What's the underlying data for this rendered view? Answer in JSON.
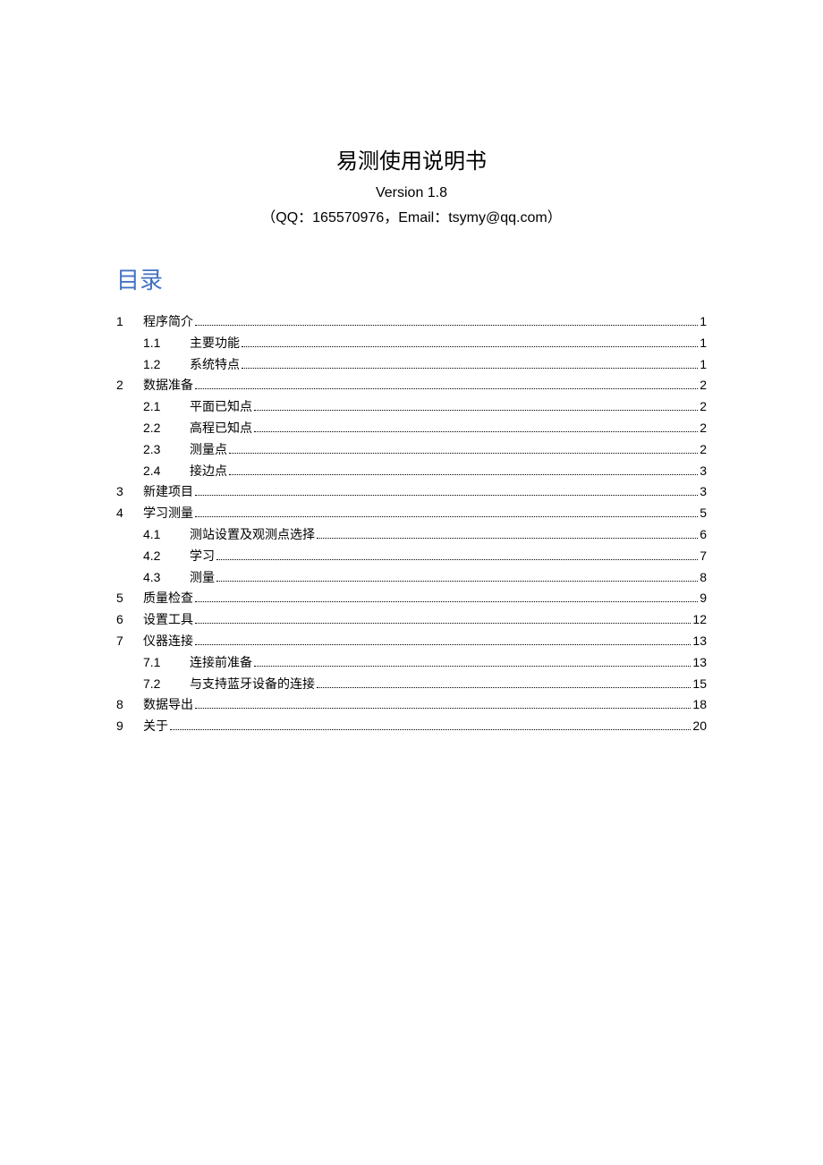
{
  "document": {
    "title": "易测使用说明书",
    "version": "Version 1.8",
    "contact": "（QQ：165570976，Email：tsymy@qq.com）",
    "toc_title": "目录",
    "toc": [
      {
        "level": 1,
        "num": "1",
        "text": "程序简介",
        "page": "1"
      },
      {
        "level": 2,
        "sub": "1.1",
        "text": "主要功能",
        "page": "1"
      },
      {
        "level": 2,
        "sub": "1.2",
        "text": "系统特点",
        "page": "1"
      },
      {
        "level": 1,
        "num": "2",
        "text": "数据准备",
        "page": "2"
      },
      {
        "level": 2,
        "sub": "2.1",
        "text": "平面已知点",
        "page": "2"
      },
      {
        "level": 2,
        "sub": "2.2",
        "text": "高程已知点",
        "page": "2"
      },
      {
        "level": 2,
        "sub": "2.3",
        "text": "测量点",
        "page": "2"
      },
      {
        "level": 2,
        "sub": "2.4",
        "text": "接边点",
        "page": "3"
      },
      {
        "level": 1,
        "num": "3",
        "text": "新建项目",
        "page": "3"
      },
      {
        "level": 1,
        "num": "4",
        "text": "学习测量",
        "page": "5"
      },
      {
        "level": 2,
        "sub": "4.1",
        "text": "测站设置及观测点选择",
        "page": "6"
      },
      {
        "level": 2,
        "sub": "4.2",
        "text": "学习",
        "page": "7"
      },
      {
        "level": 2,
        "sub": "4.3",
        "text": "测量",
        "page": "8"
      },
      {
        "level": 1,
        "num": "5",
        "text": "质量检查",
        "page": "9"
      },
      {
        "level": 1,
        "num": "6",
        "text": "设置工具",
        "page": "12"
      },
      {
        "level": 1,
        "num": "7",
        "text": "仪器连接",
        "page": "13"
      },
      {
        "level": 2,
        "sub": "7.1",
        "text": "连接前准备",
        "page": "13"
      },
      {
        "level": 2,
        "sub": "7.2",
        "text": "与支持蓝牙设备的连接",
        "page": "15"
      },
      {
        "level": 1,
        "num": "8",
        "text": "数据导出",
        "page": "18"
      },
      {
        "level": 1,
        "num": "9",
        "text": "关于",
        "page": "20"
      }
    ]
  }
}
